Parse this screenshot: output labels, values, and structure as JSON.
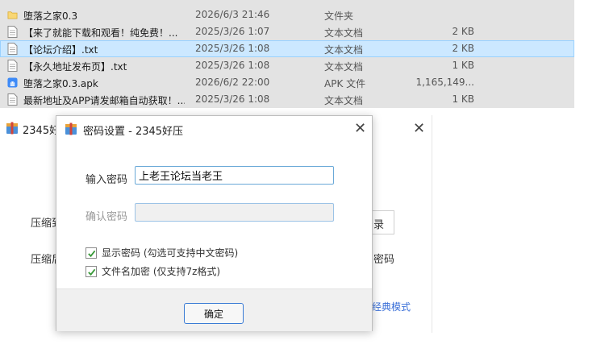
{
  "files": [
    {
      "name": "堕落之家0.3",
      "date": "2026/6/3 21:46",
      "type": "文件夹",
      "size": "",
      "icon": "folder-icon"
    },
    {
      "name": "【来了就能下载和观看！纯免费！...",
      "date": "2025/3/26 1:07",
      "type": "文本文档",
      "size": "2 KB",
      "icon": "text-file-icon"
    },
    {
      "name": "【论坛介绍】.txt",
      "date": "2025/3/26 1:08",
      "type": "文本文档",
      "size": "2 KB",
      "icon": "text-file-icon"
    },
    {
      "name": "【永久地址发布页】.txt",
      "date": "2025/3/26 1:08",
      "type": "文本文档",
      "size": "1 KB",
      "icon": "text-file-icon"
    },
    {
      "name": "堕落之家0.3.apk",
      "date": "2026/6/2 22:00",
      "type": "APK 文件",
      "size": "1,165,149...",
      "icon": "apk-file-icon"
    },
    {
      "name": "最新地址及APP请发邮箱自动获取！...",
      "date": "2025/3/26 1:08",
      "type": "文本文档",
      "size": "1 KB",
      "icon": "text-file-icon"
    }
  ],
  "bg_window": {
    "title": "2345好",
    "label_1": "压缩到",
    "label_2": "压缩后",
    "button_fragment": "录",
    "text_fragment": "密码",
    "link_fragment": "经典模式"
  },
  "dialog": {
    "title": "密码设置 - 2345好压",
    "password_label": "输入密码",
    "password_value": "上老王论坛当老王",
    "confirm_label": "确认密码",
    "confirm_value": "",
    "show_password_label": "显示密码 (勾选可支持中文密码)",
    "show_password_checked": true,
    "encrypt_names_label": "文件名加密 (仅支持7z格式)",
    "encrypt_names_checked": true,
    "ok_label": "确定"
  },
  "colors": {
    "selection": "#cce8ff",
    "accent": "#3a7bd5",
    "folder": "#f8d775",
    "apk": "#3d8af7"
  }
}
